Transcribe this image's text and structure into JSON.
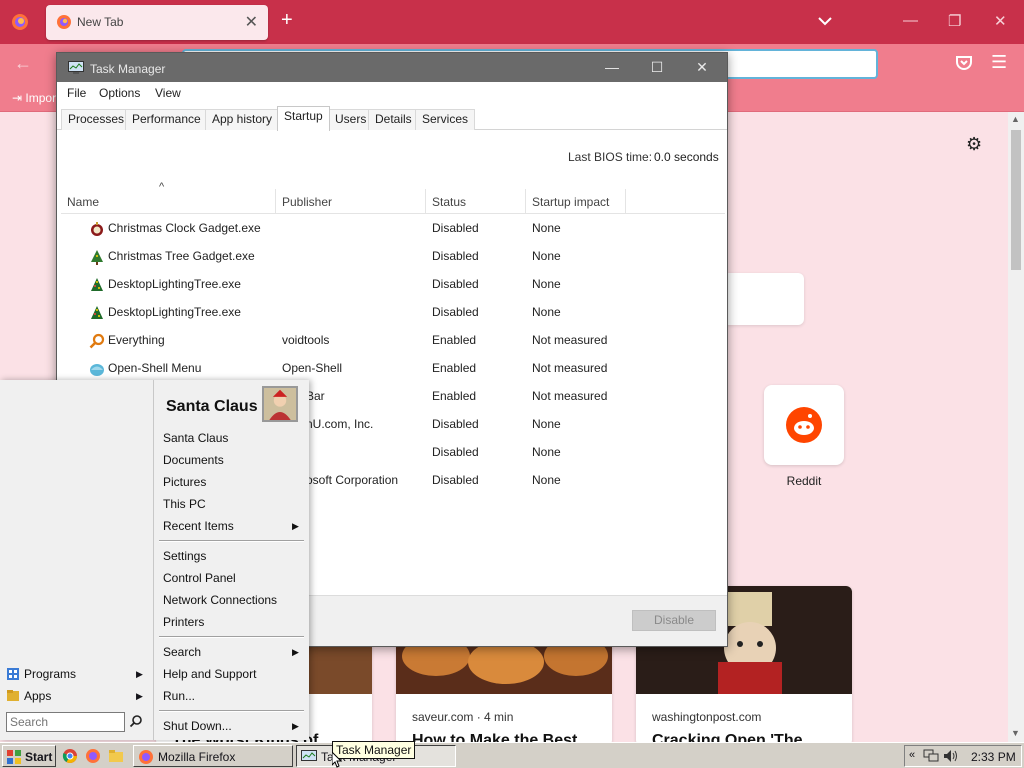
{
  "firefox": {
    "tab_title": "New Tab",
    "bookmark_import": "Import",
    "topsite_label": "Reddit",
    "stories": [
      {
        "source": "",
        "title": "The Worst Kinds of"
      },
      {
        "source": "saveur.com · 4 min",
        "title": "How to Make the Best"
      },
      {
        "source": "washingtonpost.com",
        "title": "Cracking Open 'The"
      }
    ]
  },
  "taskmanager": {
    "title": "Task Manager",
    "menu": [
      "File",
      "Options",
      "View"
    ],
    "tabs": [
      "Processes",
      "Performance",
      "App history",
      "Startup",
      "Users",
      "Details",
      "Services"
    ],
    "active_tab": "Startup",
    "bios_label": "Last BIOS time:",
    "bios_value": "0.0 seconds",
    "columns": [
      "Name",
      "Publisher",
      "Status",
      "Startup impact"
    ],
    "rows": [
      {
        "name": "Christmas Clock Gadget.exe",
        "publisher": "",
        "status": "Disabled",
        "impact": "None",
        "icon": "clock-ornament-icon"
      },
      {
        "name": "Christmas Tree Gadget.exe",
        "publisher": "",
        "status": "Disabled",
        "impact": "None",
        "icon": "christmas-tree-icon"
      },
      {
        "name": "DesktopLightingTree.exe",
        "publisher": "",
        "status": "Disabled",
        "impact": "None",
        "icon": "lighting-tree-icon"
      },
      {
        "name": "DesktopLightingTree.exe",
        "publisher": "",
        "status": "Disabled",
        "impact": "None",
        "icon": "lighting-tree-icon"
      },
      {
        "name": "Everything",
        "publisher": "voidtools",
        "status": "Enabled",
        "impact": "Not measured",
        "icon": "everything-search-icon"
      },
      {
        "name": "Open-Shell Menu",
        "publisher": "Open-Shell",
        "status": "Enabled",
        "impact": "Not measured",
        "icon": "open-shell-icon"
      },
      {
        "name": "",
        "publisher": "Bar",
        "status": "Enabled",
        "impact": "Not measured",
        "icon": ""
      },
      {
        "name": "",
        "publisher": "nU.com, Inc.",
        "status": "Disabled",
        "impact": "None",
        "icon": ""
      },
      {
        "name": "",
        "publisher": "",
        "status": "Disabled",
        "impact": "None",
        "icon": ""
      },
      {
        "name": "",
        "publisher": "osoft Corporation",
        "status": "Disabled",
        "impact": "None",
        "icon": ""
      }
    ],
    "disable_label": "Disable"
  },
  "startmenu": {
    "user": "Santa Claus",
    "items": [
      {
        "label": "Santa Claus",
        "arrow": false
      },
      {
        "label": "Documents",
        "arrow": false
      },
      {
        "label": "Pictures",
        "arrow": false
      },
      {
        "label": "This PC",
        "arrow": false
      },
      {
        "label": "Recent Items",
        "arrow": true
      },
      {
        "label": "Settings",
        "arrow": false
      },
      {
        "label": "Control Panel",
        "arrow": false
      },
      {
        "label": "Network Connections",
        "arrow": false
      },
      {
        "label": "Printers",
        "arrow": false
      },
      {
        "label": "Search",
        "arrow": true
      },
      {
        "label": "Help and Support",
        "arrow": false
      },
      {
        "label": "Run...",
        "arrow": false
      },
      {
        "label": "Shut Down...",
        "arrow": true
      }
    ],
    "left_items": [
      {
        "label": "Programs"
      },
      {
        "label": "Apps"
      }
    ],
    "search_placeholder": "Search"
  },
  "taskbar": {
    "start_label": "Start",
    "tasks": [
      "Mozilla Firefox",
      "Task Manager"
    ],
    "tooltip": "Task Manager",
    "clock": "2:33 PM"
  },
  "colors": {
    "firefox_tabbar": "#c8304a",
    "firefox_toolbar": "#f07d8d",
    "page_bg": "#fbe1e6",
    "taskbar": "#d4d0c8"
  }
}
